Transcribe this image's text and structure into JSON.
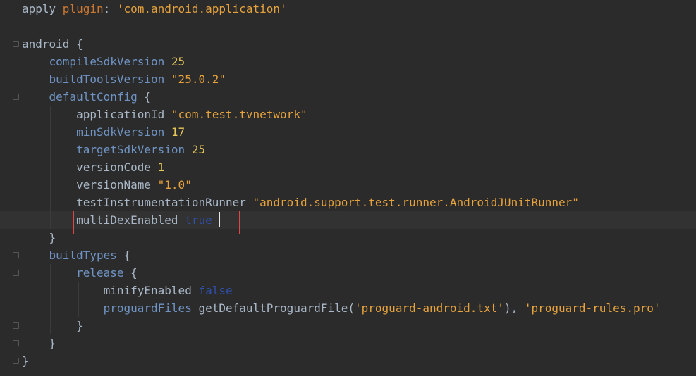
{
  "editor": {
    "lines": [
      {
        "segments": [
          {
            "text": "apply ",
            "cls": "plain"
          },
          {
            "text": "plugin",
            "cls": "key"
          },
          {
            "text": ": ",
            "cls": "plain"
          },
          {
            "text": "'com.android.application'",
            "cls": "str"
          }
        ]
      },
      {
        "segments": []
      },
      {
        "segments": [
          {
            "text": "android ",
            "cls": "plain"
          },
          {
            "text": "{",
            "cls": "plain"
          }
        ]
      },
      {
        "segments": [
          {
            "text": "    compileSdkVersion ",
            "cls": "plain"
          },
          {
            "text": "25",
            "cls": "num"
          }
        ]
      },
      {
        "segments": [
          {
            "text": "    buildToolsVersion ",
            "cls": "plain"
          },
          {
            "text": "\"25.0.2\"",
            "cls": "str"
          }
        ]
      },
      {
        "segments": [
          {
            "text": "    defaultConfig ",
            "cls": "plain"
          },
          {
            "text": "{",
            "cls": "plain"
          }
        ]
      },
      {
        "segments": [
          {
            "text": "        applicationId ",
            "cls": "plain"
          },
          {
            "text": "\"com.test.tvnetwork\"",
            "cls": "str"
          }
        ]
      },
      {
        "segments": [
          {
            "text": "        minSdkVersion ",
            "cls": "plain"
          },
          {
            "text": "17",
            "cls": "num"
          }
        ]
      },
      {
        "segments": [
          {
            "text": "        targetSdkVersion ",
            "cls": "plain"
          },
          {
            "text": "25",
            "cls": "num"
          }
        ]
      },
      {
        "segments": [
          {
            "text": "        versionCode ",
            "cls": "plain"
          },
          {
            "text": "1",
            "cls": "num"
          }
        ]
      },
      {
        "segments": [
          {
            "text": "        versionName ",
            "cls": "plain"
          },
          {
            "text": "\"1.0\"",
            "cls": "str"
          }
        ]
      },
      {
        "segments": [
          {
            "text": "        testInstrumentationRunner ",
            "cls": "plain"
          },
          {
            "text": "\"android.support.test.runner.AndroidJUnitRunner\"",
            "cls": "str"
          }
        ]
      },
      {
        "segments": [
          {
            "text": "        multiDexEnabled ",
            "cls": "plain"
          },
          {
            "text": "true",
            "cls": "bool"
          }
        ],
        "current": true
      },
      {
        "segments": [
          {
            "text": "    }",
            "cls": "plain"
          }
        ]
      },
      {
        "segments": [
          {
            "text": "    buildTypes ",
            "cls": "plain"
          },
          {
            "text": "{",
            "cls": "plain"
          }
        ]
      },
      {
        "segments": [
          {
            "text": "        release ",
            "cls": "plain"
          },
          {
            "text": "{",
            "cls": "plain"
          }
        ]
      },
      {
        "segments": [
          {
            "text": "            minifyEnabled ",
            "cls": "plain"
          },
          {
            "text": "false",
            "cls": "bool"
          }
        ]
      },
      {
        "segments": [
          {
            "text": "            proguardFiles ",
            "cls": "plain"
          },
          {
            "text": "getDefaultProguardFile(",
            "cls": "plain"
          },
          {
            "text": "'proguard-android.txt'",
            "cls": "str"
          },
          {
            "text": "), ",
            "cls": "plain"
          },
          {
            "text": "'proguard-rules.pro'",
            "cls": "str"
          }
        ]
      },
      {
        "segments": [
          {
            "text": "        }",
            "cls": "plain"
          }
        ]
      },
      {
        "segments": [
          {
            "text": "    }",
            "cls": "plain"
          }
        ]
      },
      {
        "segments": [
          {
            "text": "}",
            "cls": "plain"
          }
        ]
      }
    ]
  },
  "colors": {
    "background": "#2b2b2b",
    "current_line": "#323232",
    "highlight_box": "#e04646",
    "string": "#6a8759",
    "number": "#6897bb",
    "keyword": "#cc7832",
    "text": "#a9b7c6"
  }
}
